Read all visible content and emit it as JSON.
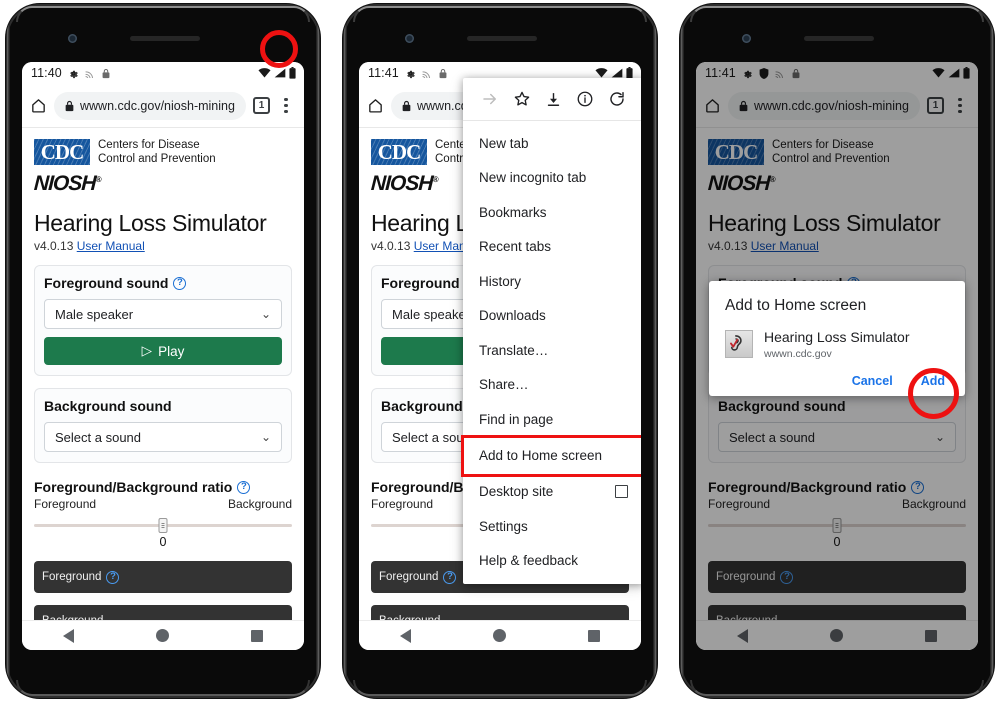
{
  "phones": [
    {
      "id": "phone-1",
      "status": {
        "time": "11:40",
        "icons": [
          "gear-icon",
          "cast-icon",
          "lock-icon"
        ],
        "right_icons": [
          "wifi-icon",
          "signal-icon",
          "battery-icon"
        ]
      },
      "omnibox": {
        "home_icon": "home-icon",
        "lock_icon": "lock-icon",
        "url": "wwwn.cdc.gov/niosh-mining",
        "tab_count": "1",
        "menu_icon": "kebab-menu-icon"
      },
      "annotation": "red-circle-on-kebab-menu"
    },
    {
      "id": "phone-2",
      "status": {
        "time": "11:41",
        "icons": [
          "gear-icon",
          "cast-icon",
          "lock-icon"
        ],
        "right_icons": [
          "wifi-icon",
          "signal-icon",
          "battery-icon"
        ]
      },
      "omnibox": {
        "home_icon": "home-icon",
        "lock_icon": "lock-icon",
        "url": "wwwn.cdc.gov/niosh-mining",
        "tab_count": "1",
        "menu_icon": "kebab-menu-icon"
      },
      "annotation": "red-box-on-add-to-home-screen"
    },
    {
      "id": "phone-3",
      "status": {
        "time": "11:41",
        "icons": [
          "gear-icon",
          "shield-icon",
          "cast-icon",
          "lock-icon"
        ],
        "right_icons": [
          "wifi-icon",
          "signal-icon",
          "battery-icon"
        ]
      },
      "omnibox": {
        "home_icon": "home-icon",
        "lock_icon": "lock-icon",
        "url": "wwwn.cdc.gov/niosh-mining",
        "tab_count": "1",
        "menu_icon": "kebab-menu-icon"
      },
      "annotation": "red-circle-on-add-button"
    }
  ],
  "page": {
    "cdc_logo_text": "CDC",
    "cdc_line1": "Centers for Disease",
    "cdc_line2": "Control and Prevention",
    "niosh_logo_text": "NIOSH",
    "title": "Hearing Loss Simulator",
    "version": "v4.0.13",
    "user_manual_link": "User Manual",
    "foreground_card": {
      "title": "Foreground sound",
      "help_icon": "question-mark-icon",
      "select_value": "Male speaker",
      "select_chevron": "chevron-down-icon",
      "play_label": "Play",
      "play_icon": "play-triangle-icon",
      "play_color": "#1d7a4c"
    },
    "background_card": {
      "title": "Background sound",
      "select_value": "Select a sound",
      "select_chevron": "chevron-down-icon"
    },
    "ratio": {
      "title": "Foreground/Background ratio",
      "help_icon": "question-mark-icon",
      "left_label": "Foreground",
      "right_label": "Background",
      "value": "0"
    },
    "panels": [
      {
        "label": "Foreground",
        "help_icon": "question-mark-icon",
        "has_help": true
      },
      {
        "label": "Background",
        "has_help": false
      }
    ]
  },
  "nav": {
    "back": "back-triangle-icon",
    "home": "home-circle-icon",
    "recents": "recents-square-icon"
  },
  "chrome_menu": {
    "top_icons": [
      {
        "name": "forward-arrow-icon",
        "enabled": false
      },
      {
        "name": "bookmark-star-icon",
        "enabled": true
      },
      {
        "name": "download-icon",
        "enabled": true
      },
      {
        "name": "page-info-icon",
        "enabled": true
      },
      {
        "name": "reload-icon",
        "enabled": true
      }
    ],
    "items": [
      {
        "label": "New tab",
        "type": "item"
      },
      {
        "label": "New incognito tab",
        "type": "item"
      },
      {
        "label": "Bookmarks",
        "type": "item"
      },
      {
        "label": "Recent tabs",
        "type": "item"
      },
      {
        "label": "History",
        "type": "item"
      },
      {
        "label": "Downloads",
        "type": "item"
      },
      {
        "label": "Translate…",
        "type": "item"
      },
      {
        "label": "Share…",
        "type": "item"
      },
      {
        "label": "Find in page",
        "type": "item"
      },
      {
        "label": "Add to Home screen",
        "type": "item",
        "highlighted": true
      },
      {
        "label": "Desktop site",
        "type": "checkbox",
        "checked": false
      },
      {
        "label": "Settings",
        "type": "item"
      },
      {
        "label": "Help & feedback",
        "type": "item"
      }
    ]
  },
  "dialog": {
    "title": "Add to Home screen",
    "app_icon": "ear-checkmark-icon",
    "app_name": "Hearing Loss Simulator",
    "host": "wwwn.cdc.gov",
    "cancel_label": "Cancel",
    "add_label": "Add",
    "link_color": "#1a73e8"
  },
  "colors": {
    "annotation_red": "#ee1111",
    "cdc_blue": "#15569e",
    "play_green": "#1d7a4c",
    "link_blue": "#1251b5"
  }
}
